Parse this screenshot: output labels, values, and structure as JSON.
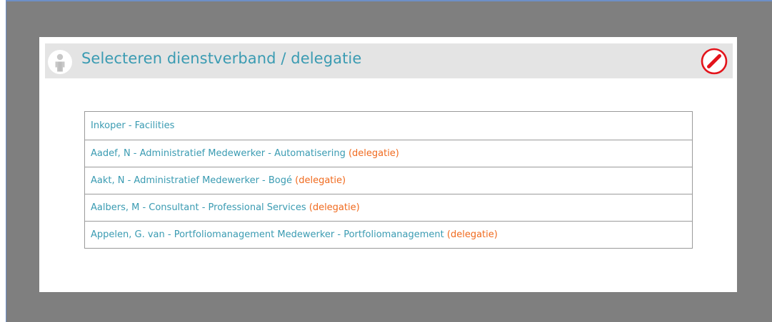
{
  "dialog": {
    "title": "Selecteren dienstverband / delegatie",
    "icons": {
      "header": "user-icon",
      "close": "close-icon"
    },
    "colors": {
      "link": "#3a9bb2",
      "delegation": "#f06a1e",
      "close": "#e3141b"
    }
  },
  "options": [
    {
      "label": "Inkoper - Facilities",
      "tag": ""
    },
    {
      "label": "Aadef, N - Administratief Medewerker - Automatisering ",
      "tag": "(delegatie)"
    },
    {
      "label": "Aakt, N - Administratief Medewerker - Bogé ",
      "tag": "(delegatie)"
    },
    {
      "label": "Aalbers, M - Consultant - Professional Services ",
      "tag": "(delegatie)"
    },
    {
      "label": "Appelen, G. van - Portfoliomanagement Medewerker - Portfoliomanagement ",
      "tag": "(delegatie)"
    }
  ]
}
